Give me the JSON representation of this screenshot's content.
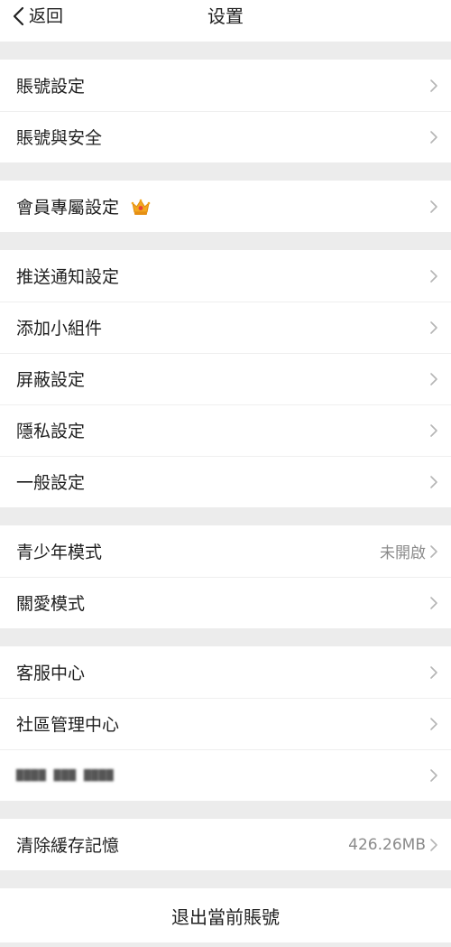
{
  "header": {
    "back_label": "返回",
    "title": "设置"
  },
  "groups": [
    {
      "items": [
        {
          "label": "賬號設定"
        },
        {
          "label": "賬號與安全"
        }
      ]
    },
    {
      "items": [
        {
          "label": "會員專屬設定",
          "icon": "crown-icon"
        }
      ]
    },
    {
      "items": [
        {
          "label": "推送通知設定"
        },
        {
          "label": "添加小組件"
        },
        {
          "label": "屏蔽設定"
        },
        {
          "label": "隱私設定"
        },
        {
          "label": "一般設定"
        }
      ]
    },
    {
      "items": [
        {
          "label": "青少年模式",
          "value": "未開啟"
        },
        {
          "label": "關愛模式"
        }
      ]
    },
    {
      "items": [
        {
          "label": "客服中心"
        },
        {
          "label": "社區管理中心"
        },
        {
          "label": "▇▇▇▇ ▇▇▇ ▇▇▇▇"
        }
      ]
    },
    {
      "items": [
        {
          "label": "清除緩存記憶",
          "value": "426.26MB"
        }
      ]
    }
  ],
  "logout": {
    "label": "退出當前賬號"
  },
  "colors": {
    "background": "#ececec",
    "row_bg": "#ffffff",
    "text": "#1f1f1f",
    "secondary_text": "#8a8a8a",
    "chevron": "#b5b5b5",
    "crown": "#f0a11c"
  }
}
